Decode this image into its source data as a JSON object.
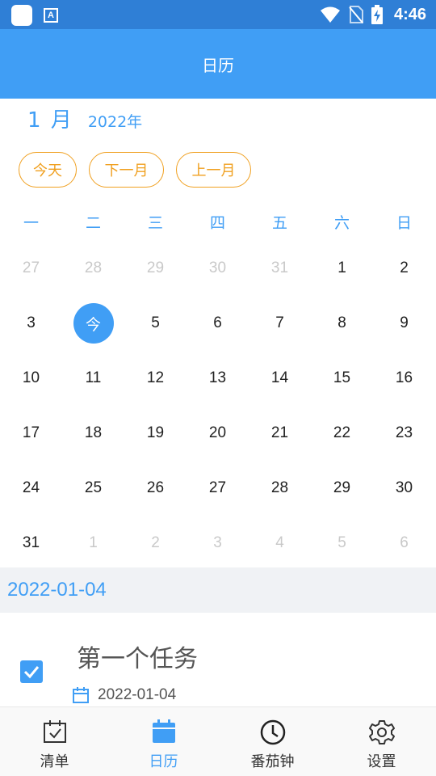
{
  "status_bar": {
    "time": "4:46",
    "app_icon_letter": "A"
  },
  "app_bar": {
    "title": "日历"
  },
  "month_header": {
    "month": "1 月",
    "year": "2022年"
  },
  "nav_buttons": {
    "today": "今天",
    "next_month": "下一月",
    "prev_month": "上一月"
  },
  "week_days": [
    "一",
    "二",
    "三",
    "四",
    "五",
    "六",
    "日"
  ],
  "calendar": {
    "rows": [
      [
        {
          "d": "27",
          "other": true
        },
        {
          "d": "28",
          "other": true
        },
        {
          "d": "29",
          "other": true
        },
        {
          "d": "30",
          "other": true
        },
        {
          "d": "31",
          "other": true
        },
        {
          "d": "1"
        },
        {
          "d": "2"
        }
      ],
      [
        {
          "d": "3"
        },
        {
          "d": "今",
          "today": true
        },
        {
          "d": "5"
        },
        {
          "d": "6"
        },
        {
          "d": "7"
        },
        {
          "d": "8"
        },
        {
          "d": "9"
        }
      ],
      [
        {
          "d": "10"
        },
        {
          "d": "11"
        },
        {
          "d": "12"
        },
        {
          "d": "13"
        },
        {
          "d": "14"
        },
        {
          "d": "15"
        },
        {
          "d": "16"
        }
      ],
      [
        {
          "d": "17"
        },
        {
          "d": "18"
        },
        {
          "d": "19"
        },
        {
          "d": "20"
        },
        {
          "d": "21"
        },
        {
          "d": "22"
        },
        {
          "d": "23"
        }
      ],
      [
        {
          "d": "24"
        },
        {
          "d": "25"
        },
        {
          "d": "26"
        },
        {
          "d": "27"
        },
        {
          "d": "28"
        },
        {
          "d": "29"
        },
        {
          "d": "30"
        }
      ],
      [
        {
          "d": "31"
        },
        {
          "d": "1",
          "other": true
        },
        {
          "d": "2",
          "other": true
        },
        {
          "d": "3",
          "other": true
        },
        {
          "d": "4",
          "other": true
        },
        {
          "d": "5",
          "other": true
        },
        {
          "d": "6",
          "other": true
        }
      ]
    ]
  },
  "selected_date": "2022-01-04",
  "task": {
    "title": "第一个任务",
    "date": "2022-01-04",
    "checked": true
  },
  "bottom_nav": [
    {
      "label": "清单",
      "icon": "checklist-calendar-icon",
      "active": false
    },
    {
      "label": "日历",
      "icon": "calendar-icon",
      "active": true
    },
    {
      "label": "番茄钟",
      "icon": "clock-icon",
      "active": false
    },
    {
      "label": "设置",
      "icon": "gear-icon",
      "active": false
    }
  ],
  "colors": {
    "primary": "#409ef5",
    "status_bar": "#2f7fd6",
    "accent_orange": "#f0a020",
    "muted_day": "#c9c9c9"
  }
}
